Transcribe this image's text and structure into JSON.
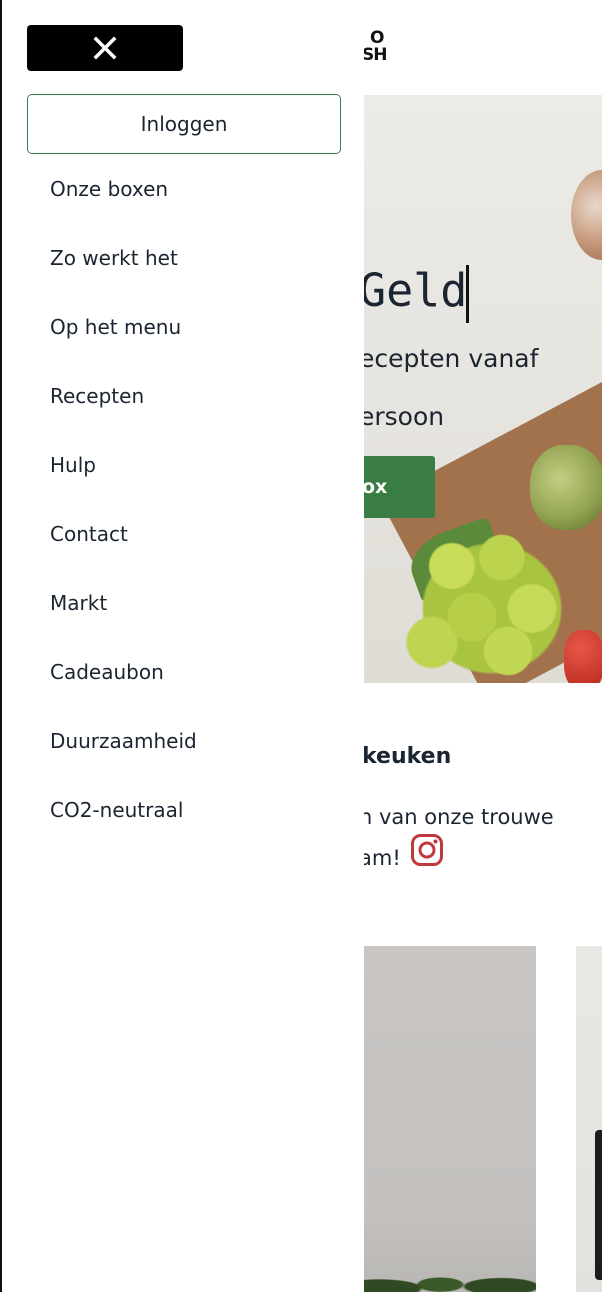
{
  "side_menu": {
    "close_label": "",
    "login_label": "Inloggen",
    "items": [
      {
        "label": "Onze boxen"
      },
      {
        "label": "Zo werkt het"
      },
      {
        "label": "Op het menu"
      },
      {
        "label": "Recepten"
      },
      {
        "label": "Hulp"
      },
      {
        "label": "Contact"
      },
      {
        "label": "Markt"
      },
      {
        "label": "Cadeaubon"
      },
      {
        "label": "Duurzaamheid"
      },
      {
        "label": "CO2-neutraal"
      }
    ]
  },
  "background": {
    "logo_line1": "O",
    "logo_line2": "SH",
    "hero_title": "Geld",
    "hero_sub1": "ecepten vanaf",
    "hero_sub2": "ersoon",
    "hero_cta": "ox",
    "section_title": "keuken",
    "section_text1": "n van onze trouwe",
    "section_text2": "am!"
  },
  "colors": {
    "accent_green": "#3a7d44",
    "close_bg": "#000000",
    "instagram": "#c0393d"
  },
  "icons": {
    "close": "close-icon",
    "instagram": "instagram-icon"
  }
}
